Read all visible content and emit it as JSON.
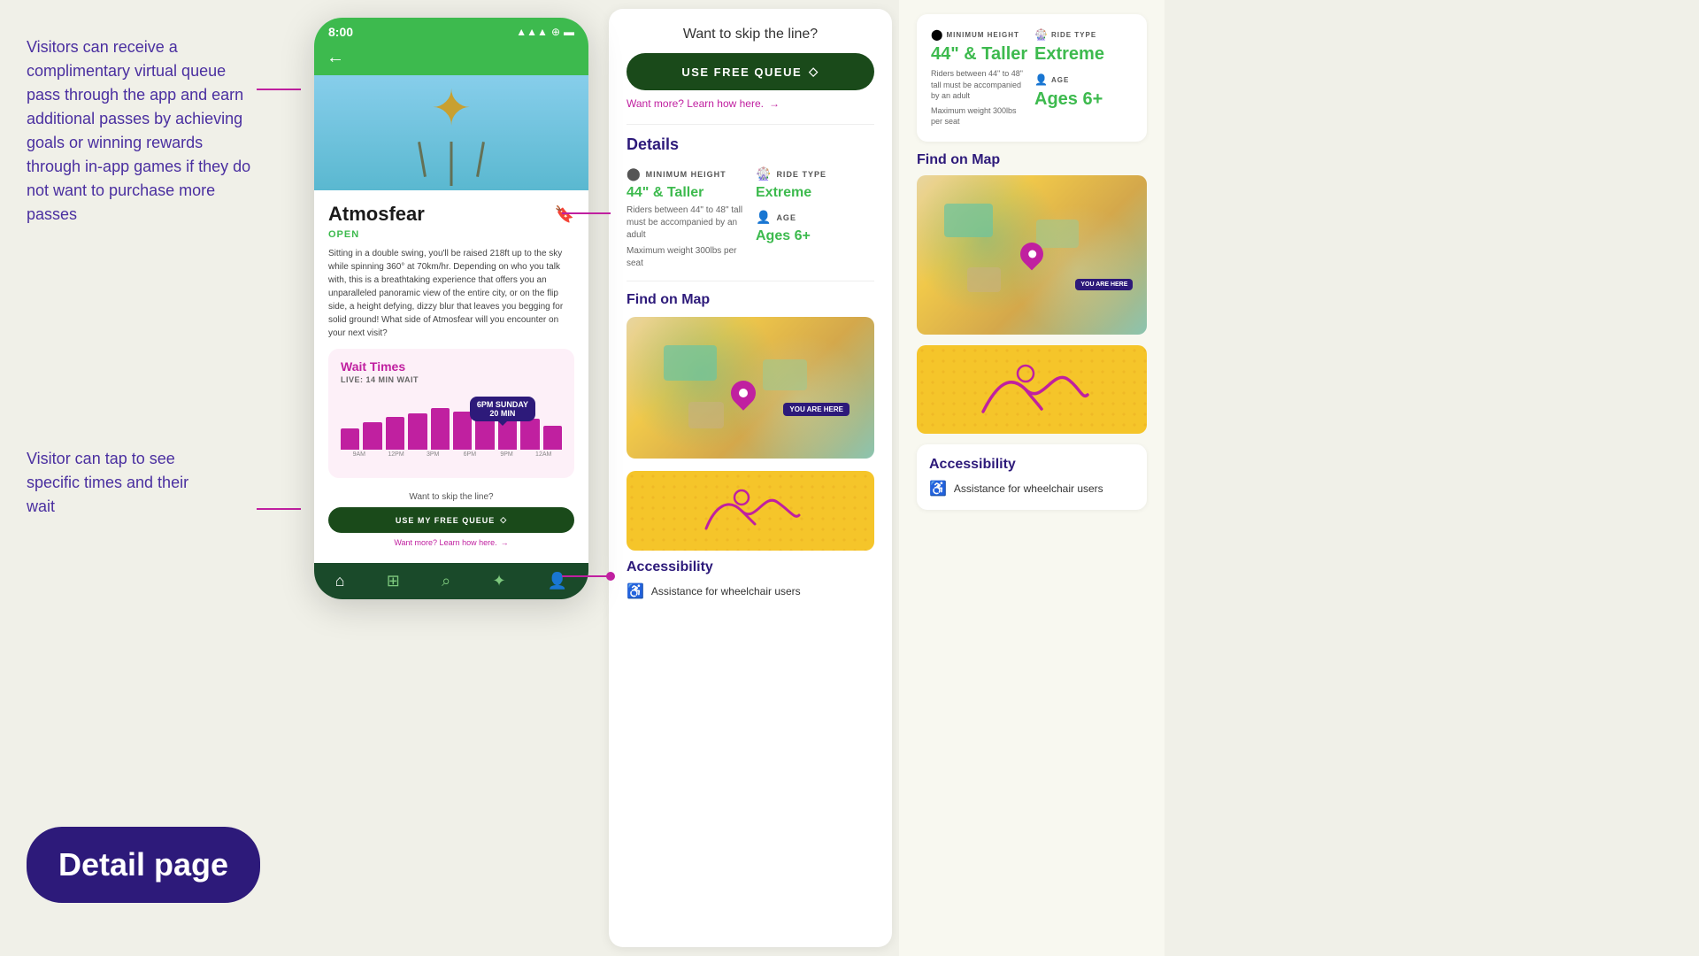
{
  "page": {
    "title": "Detail page",
    "label": "Detail page"
  },
  "left_annotation": {
    "top_text": "Visitors can receive a complimentary virtual queue pass through the app and earn additional passes by achieving goals or winning rewards through in-app games if they do not want to purchase more passes",
    "bottom_text": "Visitor can tap to see specific times and their wait"
  },
  "phone": {
    "status_bar": {
      "time": "8:00",
      "icons": "▲ ◆ ■"
    },
    "ride_name": "Atmosfear",
    "status": "OPEN",
    "description": "Sitting in a double swing, you'll be raised 218ft up to the sky while spinning 360° at 70km/hr. Depending on who you talk with, this is a breathtaking experience that offers you an unparalleled panoramic view of the entire city, or on the flip side, a height defying, dizzy blur that leaves you begging for solid ground! What side of Atmosfear will you encounter on your next visit?",
    "wait_times": {
      "title": "Wait Times",
      "live": "LIVE: 14 MIN WAIT",
      "tooltip": {
        "time": "6PM SUNDAY",
        "wait": "20 MIN"
      },
      "bars": [
        35,
        45,
        55,
        60,
        70,
        65,
        72,
        68,
        50,
        40
      ],
      "labels": [
        "9AM",
        "12PM",
        "3PM",
        "6PM",
        "9PM",
        "12AM"
      ]
    },
    "skip_line": {
      "label": "Want to skip the line?",
      "btn": "USE MY FREE QUEUE",
      "learn_more": "Want more? Learn how here."
    },
    "bottom_nav": {
      "items": [
        "⌂",
        "⊞",
        "⌕",
        "✦",
        "👤"
      ]
    }
  },
  "middle_panel": {
    "skip_line_label": "Want to skip the line?",
    "use_free_queue_btn": "USE FREE QUEUE",
    "learn_more": "Want more? Learn how here.",
    "details_title": "Details",
    "min_height_label": "MINIMUM HEIGHT",
    "min_height_value": "44\" & Taller",
    "min_height_note": "Riders between 44\" to 48\" tall must be accompanied by an adult",
    "max_weight": "Maximum weight 300lbs per seat",
    "ride_type_label": "RIDE TYPE",
    "ride_type_value": "Extreme",
    "age_label": "AGE",
    "age_value": "Ages 6+",
    "find_on_map_title": "Find on Map",
    "you_are_here": "YOU ARE HERE",
    "accessibility_title": "Accessibility",
    "accessibility_text": "Assistance for wheelchair users"
  },
  "right_panel": {
    "min_height_label": "MINIMUM HEIGHT",
    "min_height_value": "44\" & Taller",
    "min_height_note": "Riders between 44\" to 48\" tall must be accompanied by an adult",
    "max_weight": "Maximum weight 300lbs per seat",
    "ride_type_label": "RIDE TYPE",
    "ride_type_value": "Extreme",
    "age_label": "AGE",
    "age_value": "Ages 6+",
    "find_on_map_title": "Find on Map",
    "you_are_here": "YOU ARE HERE",
    "accessibility_title": "Accessibility",
    "accessibility_text": "Assistance for wheelchair users"
  },
  "colors": {
    "green": "#3dba4e",
    "purple": "#2d1a7a",
    "pink": "#c020a0",
    "dark_green_btn": "#1a4a1a"
  }
}
